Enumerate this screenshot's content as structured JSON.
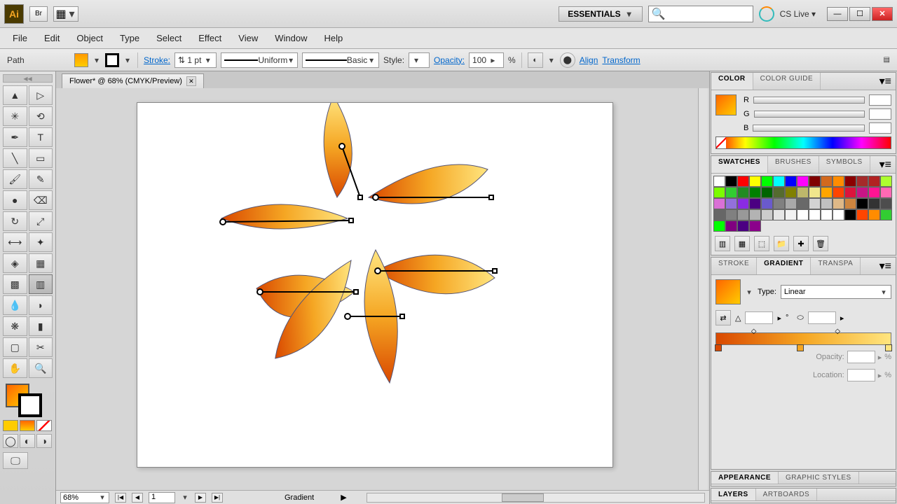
{
  "app": {
    "logo_text": "Ai",
    "br_label": "Br"
  },
  "titlebar": {
    "workspace": "ESSENTIALS",
    "cslive": "CS Live"
  },
  "menu": [
    "File",
    "Edit",
    "Object",
    "Type",
    "Select",
    "Effect",
    "View",
    "Window",
    "Help"
  ],
  "control": {
    "sel_label": "Path",
    "stroke_label": "Stroke:",
    "stroke_weight": "1 pt",
    "profile": "Uniform",
    "brush": "Basic",
    "style_label": "Style:",
    "opacity_label": "Opacity:",
    "opacity_value": "100",
    "pct": "%",
    "align": "Align",
    "transform": "Transform"
  },
  "doc": {
    "tab_title": "Flower* @ 68% (CMYK/Preview)",
    "zoom": "68%",
    "page": "1",
    "tool_hint": "Gradient"
  },
  "panels": {
    "color": {
      "tab1": "COLOR",
      "tab2": "COLOR GUIDE",
      "labels": [
        "R",
        "G",
        "B"
      ]
    },
    "swatches": {
      "tab1": "SWATCHES",
      "tab2": "BRUSHES",
      "tab3": "SYMBOLS"
    },
    "swatch_colors": [
      "#ffffff",
      "#000000",
      "#ff0000",
      "#ffff00",
      "#00ff00",
      "#00ffff",
      "#0000ff",
      "#ff00ff",
      "#800000",
      "#d2691e",
      "#ff8c00",
      "#8b0000",
      "#a52a2a",
      "#b22222",
      "#adff2f",
      "#7cfc00",
      "#32cd32",
      "#228b22",
      "#008000",
      "#006400",
      "#556b2f",
      "#808000",
      "#bdb76b",
      "#f0e68c",
      "#ffa500",
      "#ff4500",
      "#dc143c",
      "#c71585",
      "#ff1493",
      "#ff69b4",
      "#da70d6",
      "#9370db",
      "#8a2be2",
      "#4b0082",
      "#6a5acd",
      "#808080",
      "#a9a9a9",
      "#696969",
      "#d3d3d3",
      "#c0c0c0",
      "#deb887",
      "#cd853f",
      "#000000",
      "#333333",
      "#4d4d4d",
      "#666666",
      "#808080",
      "#999999",
      "#b3b3b3",
      "#cccccc",
      "#e6e6e6",
      "#f2f2f2",
      "#ffffff",
      "#ffffff",
      "#ffffff",
      "#ffffff",
      "#000000",
      "#ff4500",
      "#ff8c00",
      "#32cd32",
      "#00ff00",
      "#800080",
      "#4b0082",
      "#8b008b"
    ],
    "gradient": {
      "tab1": "STROKE",
      "tab2": "GRADIENT",
      "tab3": "TRANSPA",
      "type_label": "Type:",
      "type_value": "Linear",
      "opacity_label": "Opacity:",
      "location_label": "Location:",
      "pct": "%"
    },
    "appearance": {
      "tab1": "APPEARANCE",
      "tab2": "GRAPHIC STYLES"
    },
    "layers": {
      "tab1": "LAYERS",
      "tab2": "ARTBOARDS"
    }
  }
}
